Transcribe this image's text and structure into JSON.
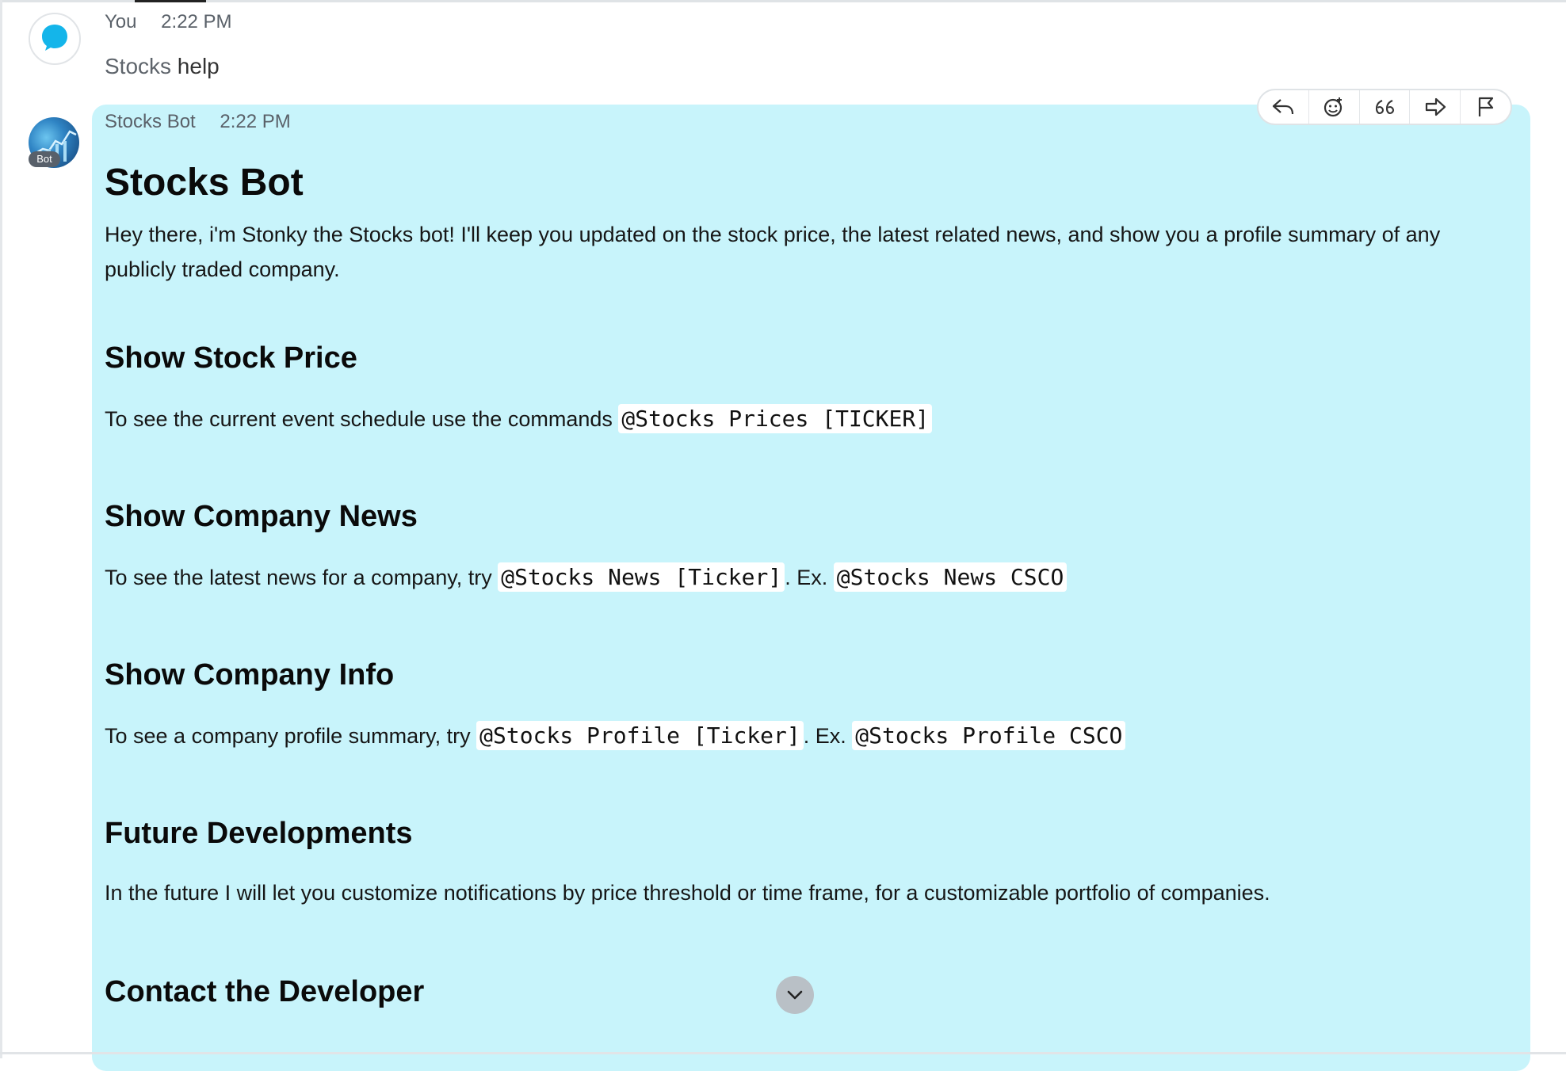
{
  "user_message": {
    "author": "You",
    "time": "2:22 PM",
    "text_part1": "Stocks",
    "text_part2": " help"
  },
  "bot_message": {
    "author": "Stocks Bot",
    "time": "2:22 PM",
    "badge": "Bot",
    "title": "Stocks Bot",
    "intro": "Hey there, i'm Stonky the Stocks bot!  I'll keep you updated on the stock price, the latest related news, and show you a profile summary of any publicly traded company.",
    "sections": [
      {
        "heading": "Show Stock Price",
        "text": "To see the current event schedule use the commands ",
        "code1": "@Stocks Prices [TICKER]"
      },
      {
        "heading": "Show Company News",
        "text": "To see the latest news for a company, try ",
        "code1": "@Stocks News [Ticker]",
        "mid": ". Ex. ",
        "code2": "@Stocks News CSCO"
      },
      {
        "heading": "Show Company Info",
        "text": "To see a company profile summary, try ",
        "code1": "@Stocks Profile [Ticker]",
        "mid": ". Ex. ",
        "code2": "@Stocks Profile CSCO"
      },
      {
        "heading": "Future Developments",
        "text": "In the future I will let you customize notifications by price threshold or time frame, for a customizable portfolio of companies."
      },
      {
        "heading": "Contact the Developer"
      }
    ]
  },
  "toolbar": {
    "icons": [
      "reply-icon",
      "emoji-icon",
      "quote-icon",
      "forward-icon",
      "flag-icon"
    ]
  },
  "colors": {
    "bot_bubble": "#c8f4fb",
    "user_icon": "#14b5ea",
    "code_bg": "#ffffff"
  }
}
